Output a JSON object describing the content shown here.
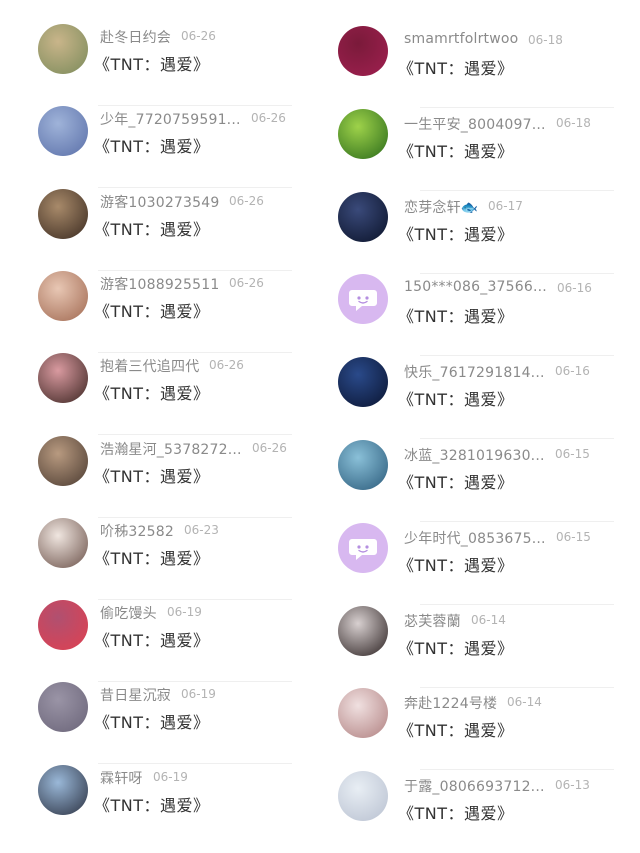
{
  "left_column": {
    "items": [
      {
        "name": "赴冬日约会",
        "date": "06-26",
        "message": "《TNT：遇爱》",
        "avatar_colors": [
          "#c9b58a",
          "#7a8a5a"
        ],
        "avatar_icon": "photo-person-icon"
      },
      {
        "name": "少年_7720759591...",
        "date": "06-26",
        "message": "《TNT：遇爱》",
        "avatar_colors": [
          "#9fb3d9",
          "#5a6fa8"
        ],
        "avatar_icon": "photo-group-icon"
      },
      {
        "name": "游客1030273549",
        "date": "06-26",
        "message": "《TNT：遇爱》",
        "avatar_colors": [
          "#a88a6a",
          "#3a2a20"
        ],
        "avatar_icon": "photo-face-icon"
      },
      {
        "name": "游客1088925511",
        "date": "06-26",
        "message": "《TNT：遇爱》",
        "avatar_colors": [
          "#e8c7b4",
          "#a06850"
        ],
        "avatar_icon": "photo-face-icon"
      },
      {
        "name": "抱着三代追四代",
        "date": "06-26",
        "message": "《TNT：遇爱》",
        "avatar_colors": [
          "#d99aa0",
          "#3a2420"
        ],
        "avatar_icon": "photo-face-icon"
      },
      {
        "name": "浩瀚星河_5378272...",
        "date": "06-26",
        "message": "《TNT：遇爱》",
        "avatar_colors": [
          "#b89a80",
          "#4a3a30"
        ],
        "avatar_icon": "photo-person-icon"
      },
      {
        "name": "吤秭32582",
        "date": "06-23",
        "message": "《TNT：遇爱》",
        "avatar_colors": [
          "#f0e6e0",
          "#6a5048"
        ],
        "avatar_icon": "photo-face-icon"
      },
      {
        "name": "偷吃馒头",
        "date": "06-19",
        "message": "《TNT：遇爱》",
        "avatar_colors": [
          "#b05070",
          "#e04050"
        ],
        "avatar_icon": "photo-person-icon"
      },
      {
        "name": "昔日星沉寂",
        "date": "06-19",
        "message": "《TNT：遇爱》",
        "avatar_colors": [
          "#9a94a6",
          "#6a6478"
        ],
        "avatar_icon": "photo-text-icon"
      },
      {
        "name": "霖轩呀",
        "date": "06-19",
        "message": "《TNT：遇爱》",
        "avatar_colors": [
          "#9ab8d8",
          "#2a3040"
        ],
        "avatar_icon": "photo-face-icon"
      }
    ]
  },
  "right_column": {
    "items": [
      {
        "name": "smamrtfolrtwoo",
        "date": "06-18",
        "message": "《TNT：遇爱》",
        "avatar_colors": [
          "#7a1a3a",
          "#a02050"
        ],
        "avatar_icon": "photo-text-icon"
      },
      {
        "name": "一生平安_8004097...",
        "date": "06-18",
        "message": "《TNT：遇爱》",
        "avatar_colors": [
          "#9ed24a",
          "#2a6a1a"
        ],
        "avatar_icon": "photo-tree-icon"
      },
      {
        "name": "恋芽念轩🐟",
        "date": "06-17",
        "message": "《TNT：遇爱》",
        "avatar_colors": [
          "#3a4a7a",
          "#0a1228"
        ],
        "avatar_icon": "photo-face-icon"
      },
      {
        "name": "150***086_37566...",
        "date": "06-16",
        "message": "《TNT：遇爱》",
        "avatar_colors": [
          "#d8b8f0",
          "#b58fe0"
        ],
        "avatar_icon": "chat-bubble-icon"
      },
      {
        "name": "快乐_7617291814...",
        "date": "06-16",
        "message": "《TNT：遇爱》",
        "avatar_colors": [
          "#2a4a8a",
          "#0a1430"
        ],
        "avatar_icon": "photo-tree-icon"
      },
      {
        "name": "冰蓝_3281019630...",
        "date": "06-15",
        "message": "《TNT：遇爱》",
        "avatar_colors": [
          "#8ac0d8",
          "#2a5a7a"
        ],
        "avatar_icon": "photo-person-icon"
      },
      {
        "name": "少年时代_0853675...",
        "date": "06-15",
        "message": "《TNT：遇爱》",
        "avatar_colors": [
          "#d8b8f0",
          "#b58fe0"
        ],
        "avatar_icon": "chat-bubble-icon"
      },
      {
        "name": "苾芙蓉蘭",
        "date": "06-14",
        "message": "《TNT：遇爱》",
        "avatar_colors": [
          "#d8d0d0",
          "#2a2020"
        ],
        "avatar_icon": "photo-face-icon"
      },
      {
        "name": "奔赴1224号楼",
        "date": "06-14",
        "message": "《TNT：遇爱》",
        "avatar_colors": [
          "#f0e0e0",
          "#b08080"
        ],
        "avatar_icon": "photo-group-icon"
      },
      {
        "name": "于露_0806693712...",
        "date": "06-13",
        "message": "《TNT：遇爱》",
        "avatar_colors": [
          "#e8eef4",
          "#b8c0d0"
        ],
        "avatar_icon": "photo-face-icon"
      }
    ]
  }
}
